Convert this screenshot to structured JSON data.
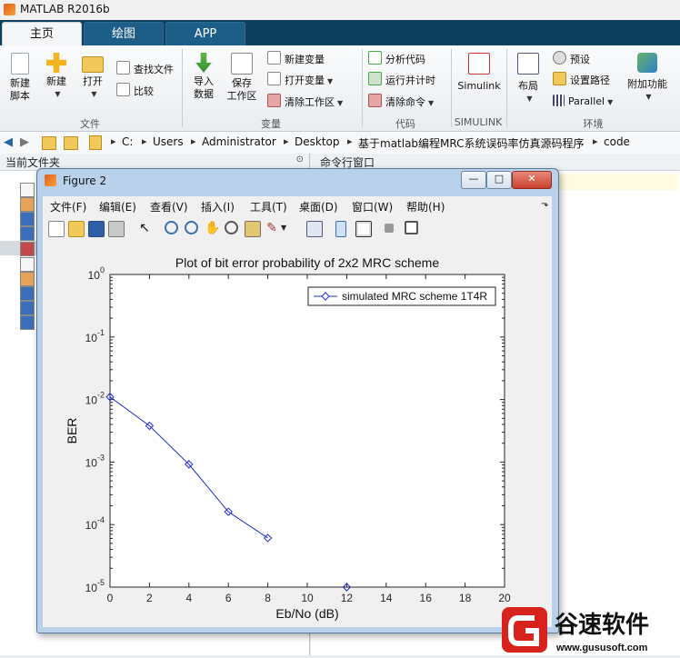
{
  "window": {
    "title": "MATLAB R2016b"
  },
  "tabs": [
    {
      "label": "主页",
      "active": true
    },
    {
      "label": "绘图",
      "active": false
    },
    {
      "label": "APP",
      "active": false
    }
  ],
  "ribbon": {
    "file": {
      "new_script": [
        "新建",
        "脚本"
      ],
      "new": "新建",
      "open": "打开",
      "find_files": "查找文件",
      "compare": "比较",
      "group": "文件"
    },
    "variable": {
      "import": [
        "导入",
        "数据"
      ],
      "save_ws": [
        "保存",
        "工作区"
      ],
      "new_var": "新建变量",
      "open_var": "打开变量",
      "clear_ws": "清除工作区",
      "group": "变量"
    },
    "code": {
      "analyze": "分析代码",
      "run_time": "运行并计时",
      "clear_cmd": "清除命令",
      "group": "代码"
    },
    "simulink": {
      "label": "Simulink",
      "group": "SIMULINK"
    },
    "env": {
      "layout": "布局",
      "prefs": "预设",
      "set_path": "设置路径",
      "parallel": "Parallel",
      "addons": "附加功能",
      "group": "环境"
    }
  },
  "address": {
    "crumbs": [
      "C:",
      "Users",
      "Administrator",
      "Desktop",
      "基于matlab编程MRC系统误码率仿真源码程序",
      "code"
    ]
  },
  "panels": {
    "left_title": "当前文件夹",
    "right_title": "命令行窗口"
  },
  "figure": {
    "title": "Figure 2",
    "buttons": [
      "—",
      "□",
      "✕"
    ],
    "menus": [
      "文件(F)",
      "编辑(E)",
      "查看(V)",
      "插入(I)",
      "工具(T)",
      "桌面(D)",
      "窗口(W)",
      "帮助(H)"
    ]
  },
  "chart_data": {
    "type": "line",
    "title": "Plot of bit error probability of 2x2 MRC scheme",
    "xlabel": "Eb/No (dB)",
    "ylabel": "BER",
    "xlim": [
      0,
      20
    ],
    "ylim": [
      1e-05,
      1
    ],
    "yscale": "log",
    "xticks": [
      0,
      2,
      4,
      6,
      8,
      10,
      12,
      14,
      16,
      18,
      20
    ],
    "yticks": [
      {
        "base": "10",
        "exp": "0"
      },
      {
        "base": "10",
        "exp": "-1"
      },
      {
        "base": "10",
        "exp": "-2"
      },
      {
        "base": "10",
        "exp": "-3"
      },
      {
        "base": "10",
        "exp": "-4"
      },
      {
        "base": "10",
        "exp": "-5"
      }
    ],
    "grid": false,
    "legend_position": "top-right",
    "series": [
      {
        "name": "simulated MRC scheme 1T4R",
        "color": "#1f2fd0",
        "marker": "diamond",
        "x": [
          0,
          2,
          4,
          6,
          8,
          10,
          12
        ],
        "y": [
          0.011,
          0.0038,
          0.00092,
          0.00016,
          6.1e-05,
          null,
          1e-05
        ]
      }
    ]
  },
  "watermark": {
    "text": "谷速软件",
    "url": "www.gususoft.com"
  }
}
